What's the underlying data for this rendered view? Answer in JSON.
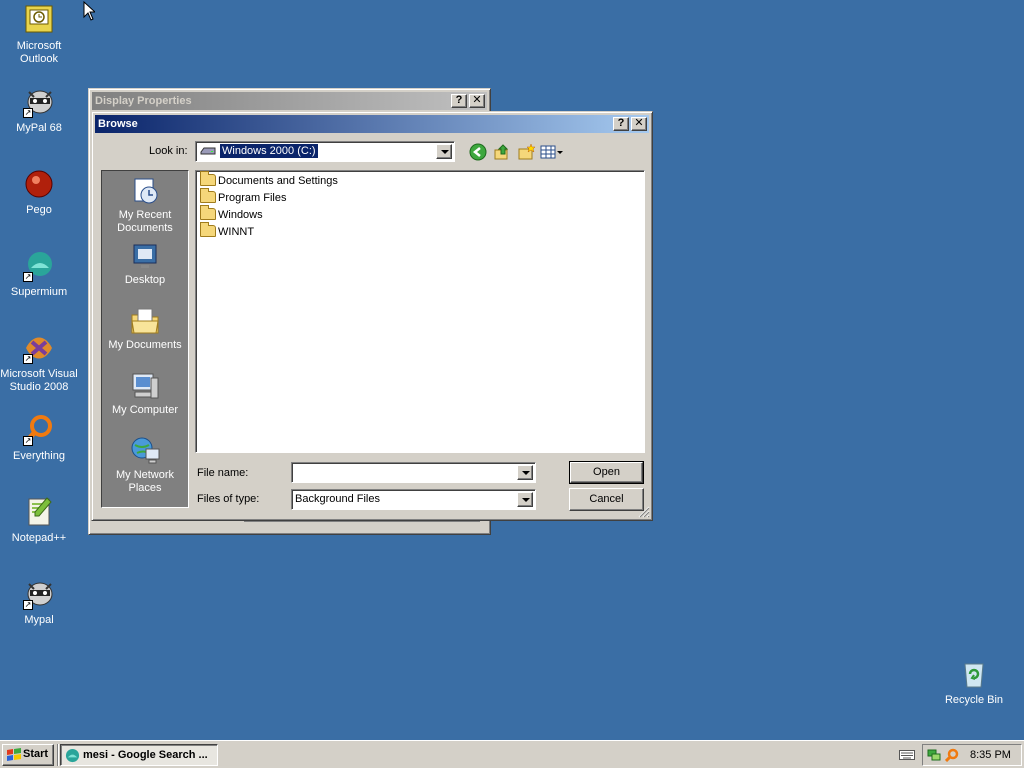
{
  "desktop": {
    "icons": [
      {
        "label": "Microsoft Outlook",
        "icon": "outlook-icon"
      },
      {
        "label": "MyPal 68",
        "icon": "mypal-icon"
      },
      {
        "label": "Pego",
        "icon": "pego-icon"
      },
      {
        "label": "Supermium",
        "icon": "supermium-icon"
      },
      {
        "label": "Microsoft Visual Studio 2008",
        "icon": "visual-studio-icon"
      },
      {
        "label": "Everything",
        "icon": "everything-icon"
      },
      {
        "label": "Notepad++",
        "icon": "notepadpp-icon"
      },
      {
        "label": "Mypal",
        "icon": "mypal-icon"
      }
    ],
    "recycle_bin": {
      "label": "Recycle Bin",
      "icon": "recycle-bin-icon"
    }
  },
  "display_properties": {
    "title": "Display Properties",
    "help_label": "?",
    "close_label": "✕"
  },
  "browse": {
    "title": "Browse",
    "help_label": "?",
    "close_label": "✕",
    "look_in_label": "Look in:",
    "look_in_value": "Windows 2000 (C:)",
    "places": [
      {
        "label": "My Recent Documents",
        "icon": "recent-documents-icon"
      },
      {
        "label": "Desktop",
        "icon": "desktop-icon"
      },
      {
        "label": "My Documents",
        "icon": "my-documents-icon"
      },
      {
        "label": "My Computer",
        "icon": "my-computer-icon"
      },
      {
        "label": "My Network Places",
        "icon": "network-places-icon"
      }
    ],
    "files": [
      {
        "name": "Documents and Settings",
        "icon": "folder-icon"
      },
      {
        "name": "Program Files",
        "icon": "folder-icon"
      },
      {
        "name": "Windows",
        "icon": "folder-icon"
      },
      {
        "name": "WINNT",
        "icon": "folder-icon"
      }
    ],
    "file_name_label": "File name:",
    "file_name_value": "",
    "files_of_type_label": "Files of type:",
    "files_of_type_value": "Background Files",
    "open_label": "Open",
    "cancel_label": "Cancel"
  },
  "taskbar": {
    "start_label": "Start",
    "task_label": "mesi - Google Search ...",
    "clock": "8:35 PM"
  },
  "colors": {
    "desktop": "#3a6ea5",
    "active_title": "#0a246a",
    "inactive_title": "#808080",
    "face": "#d4d0c8"
  }
}
